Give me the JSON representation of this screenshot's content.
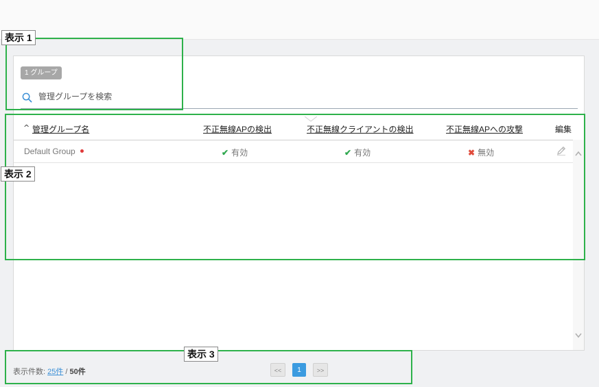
{
  "header": {
    "group_count_badge": "1 グループ"
  },
  "search": {
    "placeholder": "管理グループを検索",
    "value": ""
  },
  "table": {
    "columns": [
      {
        "label": "管理グループ名",
        "sort": "ascending",
        "sort_glyph": "^"
      },
      {
        "label": "不正無線APの検出"
      },
      {
        "label": "不正無線クライアントの検出"
      },
      {
        "label": "不正無線APへの攻撃"
      },
      {
        "label": "編集"
      }
    ],
    "rows": [
      {
        "name": "Default Group",
        "rogue_ap_detection": {
          "status": "enabled",
          "label": "有効"
        },
        "rogue_client_detection": {
          "status": "enabled",
          "label": "有効"
        },
        "rogue_ap_attack": {
          "status": "disabled",
          "label": "無効"
        }
      }
    ]
  },
  "footer": {
    "label": "表示件数: ",
    "page_size_link": "25件",
    "separator": " / ",
    "total": "50件"
  },
  "pager": {
    "prev_label": "<<",
    "current_page": "1",
    "next_label": ">>"
  },
  "annotations": [
    {
      "label": "表示 1"
    },
    {
      "label": "表示 2"
    },
    {
      "label": "表示 3"
    }
  ],
  "colors": {
    "accent": "#3b9be0",
    "annotation_green": "#2db14a",
    "enabled_green": "#2fa84f",
    "disabled_red": "#e04b3b",
    "status_dot_red": "#e03a3a"
  },
  "icons": [
    "search-icon",
    "check-icon",
    "cross-icon",
    "pencil-icon",
    "chevron-up-icon",
    "chevron-down-icon"
  ]
}
